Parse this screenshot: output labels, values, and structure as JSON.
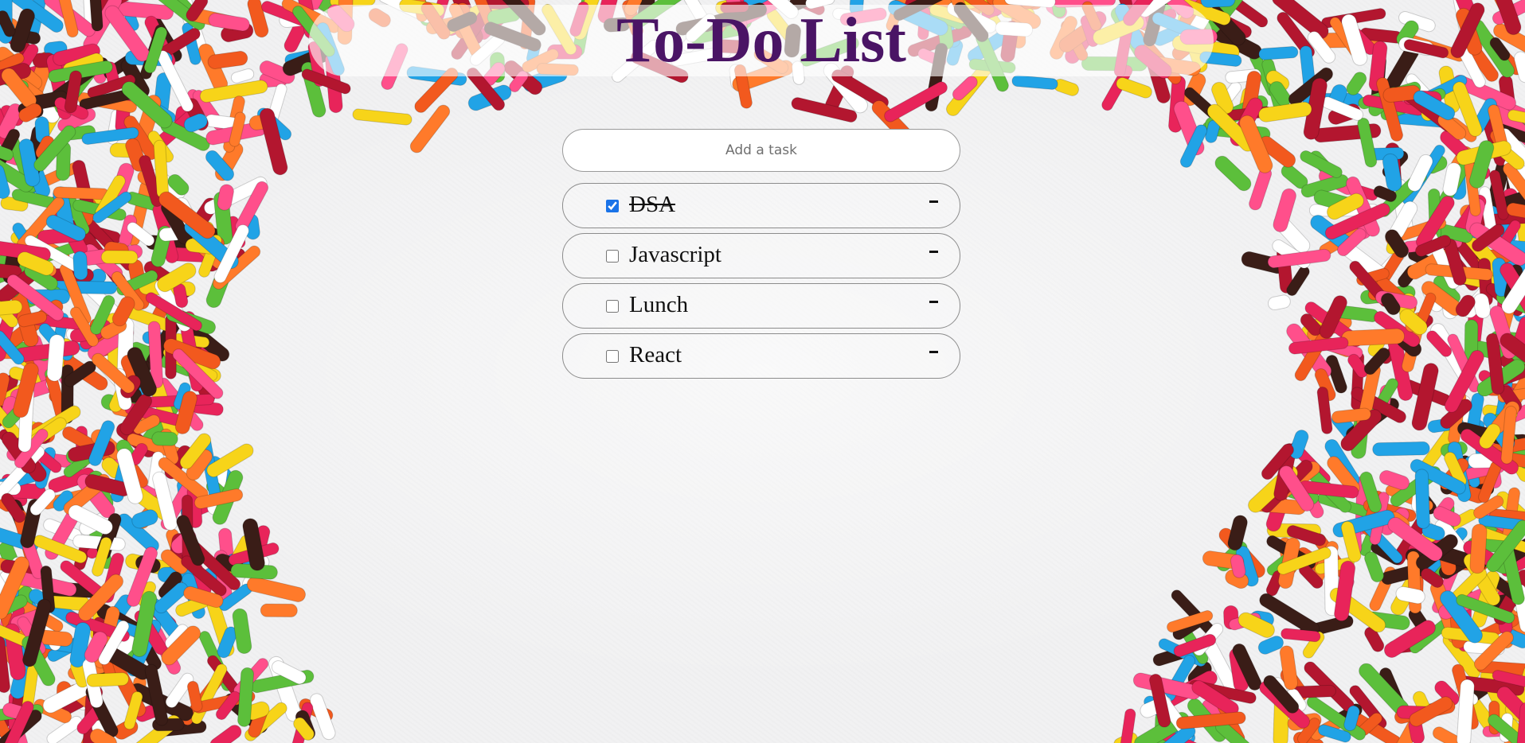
{
  "header": {
    "title": "To-Do List"
  },
  "new_task": {
    "placeholder": "Add a task",
    "value": ""
  },
  "tasks": [
    {
      "label": "DSA",
      "completed": true,
      "remove_icon": "minus-icon"
    },
    {
      "label": "Javascript",
      "completed": false,
      "remove_icon": "minus-icon"
    },
    {
      "label": "Lunch",
      "completed": false,
      "remove_icon": "minus-icon"
    },
    {
      "label": "React",
      "completed": false,
      "remove_icon": "minus-icon"
    }
  ],
  "colors": {
    "title": "#4a1465",
    "background": "#f1f1f2",
    "checkbox_accent": "#1a73e8",
    "sprinkles": [
      "#e8245a",
      "#21a3e6",
      "#f7d419",
      "#5cbf3b",
      "#f2591e",
      "#b3162f",
      "#3a1d17",
      "#ffffff",
      "#ff4f8b",
      "#ff7a2a"
    ]
  }
}
